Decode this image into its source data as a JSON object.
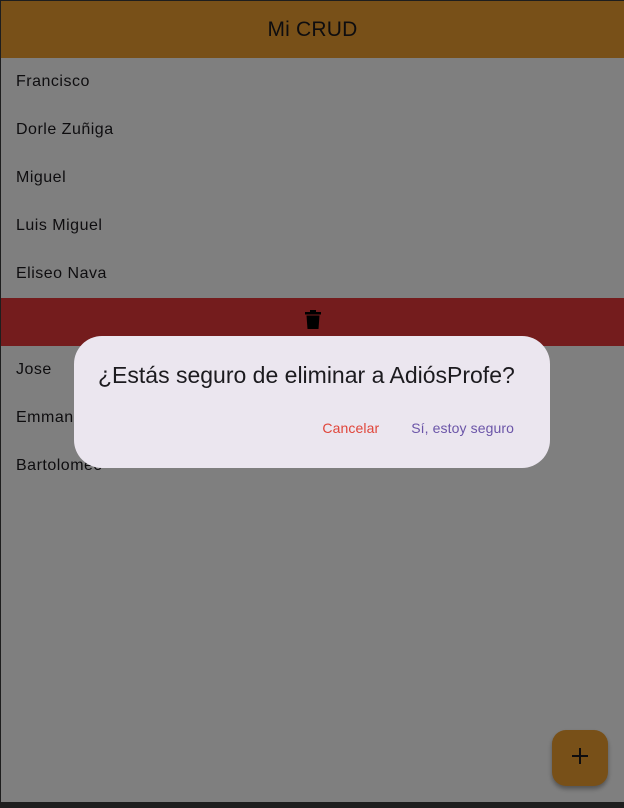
{
  "appbar": {
    "title": "Mi CRUD"
  },
  "list": {
    "items_before": [
      "Francisco",
      "Dorle Zuñiga",
      "Miguel",
      "Luis Miguel",
      "Eliseo Nava"
    ],
    "items_after": [
      "Jose",
      "Emmanuel",
      "Bartolomeo"
    ]
  },
  "dismiss": {
    "icon": "trash-icon",
    "color": "#e8393a"
  },
  "dialog": {
    "title": "¿Estás seguro de eliminar a AdiósProfe?",
    "cancel_label": "Cancelar",
    "confirm_label": "Sí, estoy seguro"
  },
  "fab": {
    "icon": "plus-icon"
  },
  "colors": {
    "primary": "#f0a030",
    "danger": "#e8393a",
    "dialog_surface": "#ebe6ef",
    "accent": "#6b55a8"
  }
}
